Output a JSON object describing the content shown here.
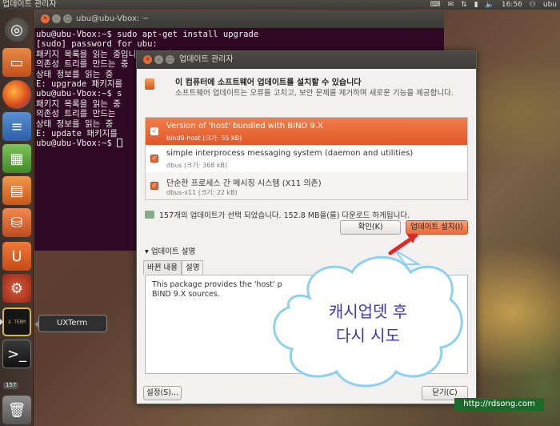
{
  "top_panel": {
    "title": "업데이트 관리자",
    "time": "16:56",
    "user": "ubu"
  },
  "launcher": {
    "tooltip": "UXTerm",
    "xterm_label": "X TERM",
    "badge": "157"
  },
  "terminal": {
    "title": "ubu@ubu-Vbox: ~",
    "lines": [
      "ubu@ubu-Vbox:~$ sudo apt-get install upgrade",
      "[sudo] password for ubu:",
      "패키지 목록을 읽는 중입니다... 완료",
      "의존성 트리를 만드는 중",
      "상태 정보를 읽는 중",
      "E: upgrade 패키지를",
      "ubu@ubu-Vbox:~$ s",
      "패키지 목록을 읽는 중",
      "의존성 트리를 만드는",
      "상태 정보를 읽는 중",
      "E: update 패키지를",
      "ubu@ubu-Vbox:~$ "
    ]
  },
  "update_manager": {
    "title": "업데이트 관리자",
    "heading": "이 컴퓨터에 소프트웨어 업데이트를 설치할 수 있습니다",
    "description": "소프트웨어 업데이트는 오류를 고치고, 보안 문제를 제거하며 새로운 기능을 제공합니다.",
    "updates": [
      {
        "name": "Version of 'host' bundled with BIND 9.X",
        "sub": "bind9-host (크기: 55 kB)"
      },
      {
        "name": "simple interprocess messaging system (daemon and utilities)",
        "sub": "dbus (크기: 368 kB)"
      },
      {
        "name": "단순한 프로세스 간 메시징 시스템 (X11 의존)",
        "sub": "dbus-x11 (크기: 22 kB)"
      }
    ],
    "summary": "157개의 업데이트가 선택 되었습니다. 152.8 MB을(를) 다운로드 하게됩니다.",
    "check_button": "확인(K)",
    "install_button": "업데이트 설치(I)",
    "description_toggle": "업데이트 설명",
    "tabs": [
      "바뀐 내용",
      "설명"
    ],
    "desc_text": "This package provides the 'host' p\nBIND 9.X sources.",
    "settings_button": "설정(S)...",
    "close_button": "닫기(C)"
  },
  "callout": {
    "line1": "캐시업뎃 후",
    "line2": "다시 시도"
  },
  "watermark": "http://rdsong.com",
  "colors": {
    "accent": "#e1582a",
    "terminal_bg": "#300a24",
    "callout_text": "#3b3aa8",
    "cloud_border": "#8fd0f0"
  }
}
